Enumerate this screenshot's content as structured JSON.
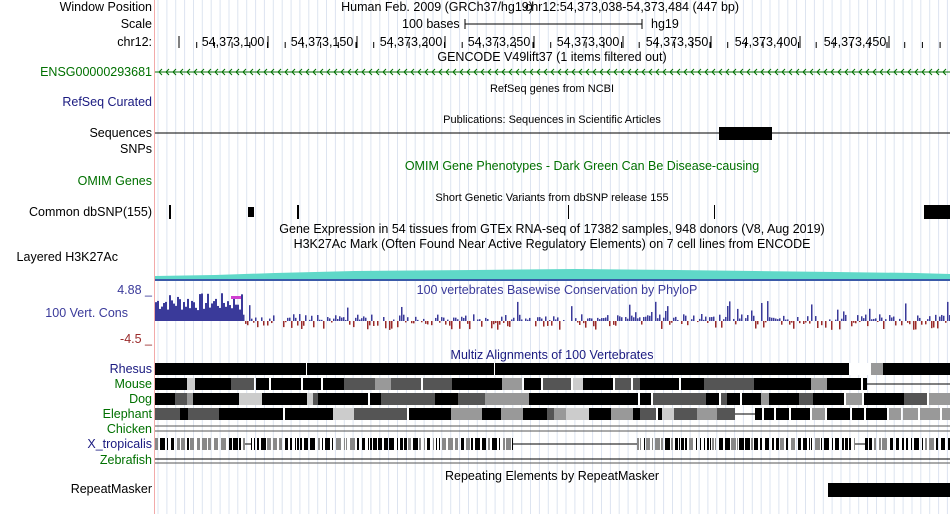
{
  "colors": {
    "accent_green": "#007000",
    "accent_navy": "#1a1a80",
    "conservation_blue": "#3a3a9a",
    "conservation_red": "#9a2a2a",
    "divider_pink": "#f2aaaa",
    "grid": "#dde4f0",
    "h3k27ac_teal": "#5fd8c8"
  },
  "labels": {
    "window_position": "Window Position",
    "scale": "Scale",
    "chrom": "chr12:",
    "ensg": "ENSG00000293681",
    "refseq": "RefSeq Curated",
    "sequences": "Sequences",
    "snps": "SNPs",
    "omim_genes": "OMIM Genes",
    "common_dbsnp": "Common dbSNP(155)",
    "layered_h3k27ac": "Layered H3K27Ac",
    "cons_max": "4.88 _",
    "cons_label": "100 Vert. Cons",
    "cons_min": "-4.5 _",
    "species": [
      "Rhesus",
      "Mouse",
      "Dog",
      "Elephant",
      "Chicken",
      "X_tropicalis",
      "Zebrafish"
    ],
    "repeatmasker": "RepeatMasker"
  },
  "header": {
    "assembly": "Human Feb. 2009 (GRCh37/hg19)",
    "position": "chr12:54,373,038-54,373,484 (447 bp)",
    "scale_text": "100 bases",
    "scale_db": "hg19",
    "ticks": [
      "54,373,100",
      "54,373,150",
      "54,373,200",
      "54,373,250",
      "54,373,300",
      "54,373,350",
      "54,373,400",
      "54,373,450"
    ]
  },
  "tracks": {
    "gencode": "GENCODE V49lift37 (1 items filtered out)",
    "refseq_desc": "RefSeq genes from NCBI",
    "publications": "Publications: Sequences in Scientific Articles",
    "omim_desc": "OMIM Gene Phenotypes - Dark Green Can Be Disease-causing",
    "snp_desc": "Short Genetic Variants from dbSNP release 155",
    "gtex_desc": "Gene Expression in 54 tissues from GTEx RNA-seq of 17382 samples, 948 donors (V8, Aug 2019)",
    "h3k27ac_desc": "H3K27Ac Mark (Often Found Near Active Regulatory Elements) on 7 cell lines from ENCODE",
    "phylop_desc": "100 vertebrates Basewise Conservation by PhyloP",
    "multiz_desc": "Multiz Alignments of 100 Vertebrates",
    "repeat_desc": "Repeating Elements by RepeatMasker"
  }
}
